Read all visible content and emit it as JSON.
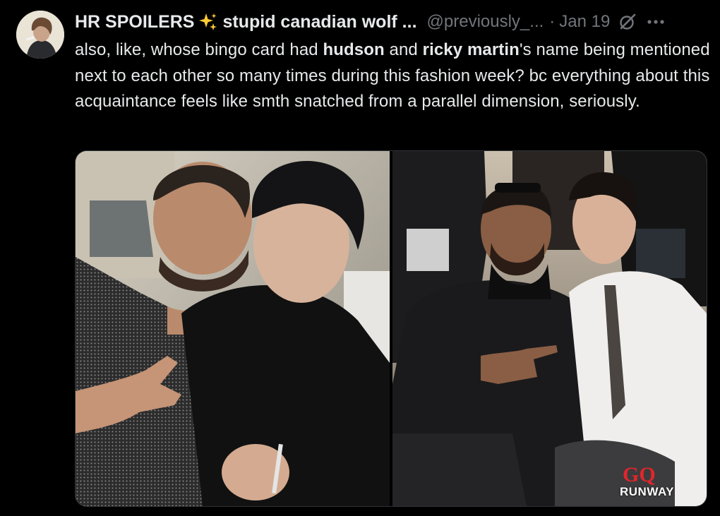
{
  "tweet": {
    "display_name": "HR SPOILERS",
    "display_name_suffix": "stupid canadian wolf ...",
    "handle": "@previously_...",
    "separator": "·",
    "date": "Jan 19",
    "text_segments": [
      {
        "t": "also, like, whose bingo card had ",
        "bold": false
      },
      {
        "t": "hudson",
        "bold": true
      },
      {
        "t": " and ",
        "bold": false
      },
      {
        "t": "ricky martin",
        "bold": true
      },
      {
        "t": "'s name being mentioned next to each other so many times during this fashion week? bc everything about this acquaintance feels like smth snatched from a parallel dimension, seriously.",
        "bold": false
      }
    ]
  },
  "media": {
    "overlay_brand": "GQ",
    "overlay_label": "RUNWAY"
  },
  "icons": {
    "sparkle": "sparkles-icon",
    "grok": "grok-icon",
    "more": "more-icon"
  },
  "colors": {
    "background": "#000000",
    "text": "#e7e9ea",
    "muted": "#71767b",
    "sparkle": "#ffcc33",
    "gq_red": "#e0262b"
  }
}
